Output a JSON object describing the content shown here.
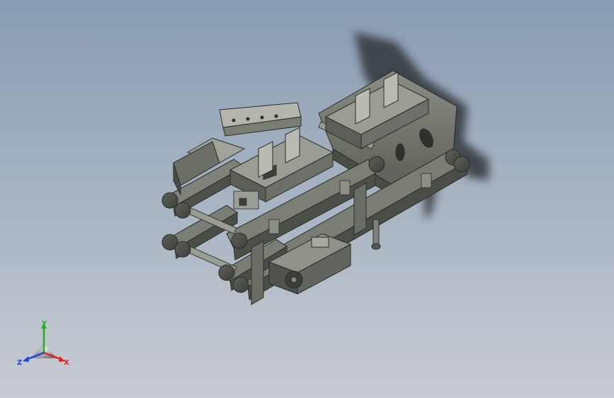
{
  "viewport": {
    "background_top": "#8a9cb3",
    "background_bottom": "#c9ccd2"
  },
  "model": {
    "body_color": "#6f7268",
    "edge_color": "#2a2c28",
    "shadow_color": "#2b2f33"
  },
  "triad": {
    "x_label": "X",
    "y_label": "Y",
    "z_label": "Z",
    "x_color": "#e02020",
    "y_color": "#20b020",
    "z_color": "#2040e0"
  }
}
